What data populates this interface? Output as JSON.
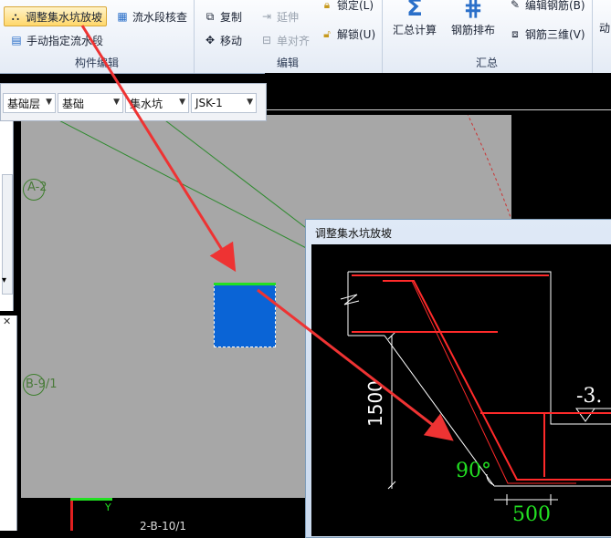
{
  "ribbon": {
    "groups": {
      "component_edit": {
        "label": "构件编辑",
        "adjust_pit_slope": "调整集水坑放坡",
        "flow_check": "流水段核查",
        "manual_flow": "手动指定流水段"
      },
      "edit": {
        "label": "编辑",
        "copy": "复制",
        "extend": "延伸",
        "move": "移动",
        "align": "单对齐",
        "lock": "锁定(L)",
        "unlock": "解锁(U)"
      },
      "summary": {
        "label": "汇总",
        "sum_calc": "汇总计算",
        "rebar_layout": "钢筋排布",
        "edit_rebar": "编辑钢筋(B)",
        "rebar_3d": "钢筋三维(V)",
        "partial": "动"
      }
    }
  },
  "selector": {
    "layer": "基础层",
    "type": "基础",
    "component": "集水坑",
    "name": "JSK-1"
  },
  "canvas": {
    "axis_a": "A-2",
    "axis_b": "B-9/1",
    "axis_bottom": "2-B-10/1",
    "y_label": "Y"
  },
  "dialog": {
    "title": "调整集水坑放坡",
    "depth": "1500",
    "angle": "90°",
    "width": "500",
    "elevation": "-3."
  },
  "colors": {
    "pit_fill": "#0a64d6",
    "rebar": "#ff2a2a",
    "annotation": "#22e022",
    "arrow": "#ee3333"
  }
}
